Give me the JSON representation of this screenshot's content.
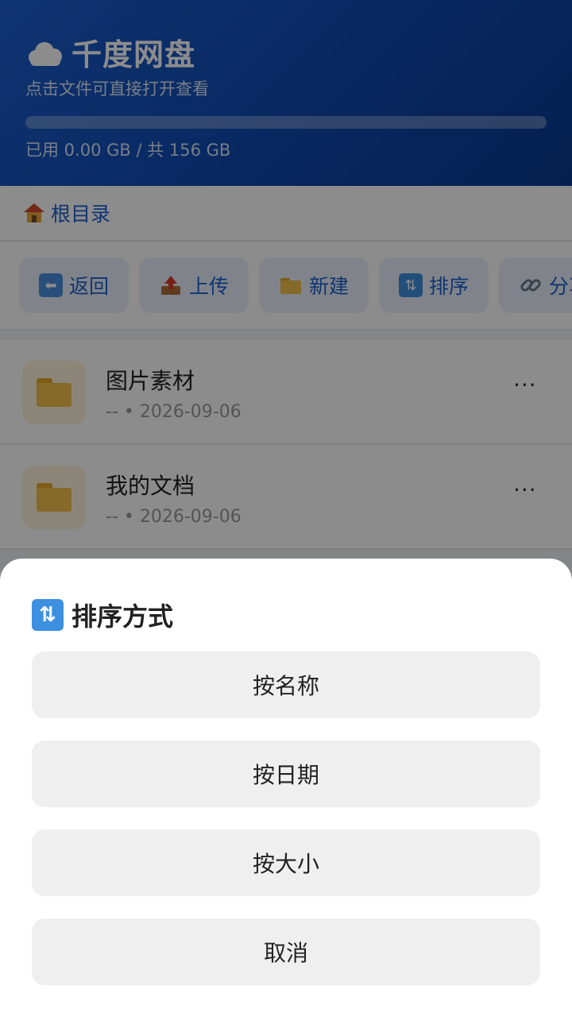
{
  "header": {
    "app_name": "千度网盘",
    "subtitle": "点击文件可直接打开查看",
    "usage_text": "已用 0.00 GB / 共 156 GB",
    "usage_fraction": 0.0
  },
  "breadcrumb": {
    "label": "根目录"
  },
  "toolbar": {
    "buttons": [
      {
        "label": "返回",
        "icon": "back-arrow-icon"
      },
      {
        "label": "上传",
        "icon": "upload-icon"
      },
      {
        "label": "新建",
        "icon": "folder-icon"
      },
      {
        "label": "排序",
        "icon": "sort-icon"
      },
      {
        "label": "分享",
        "icon": "link-icon"
      }
    ]
  },
  "files": [
    {
      "name": "图片素材",
      "size": "--",
      "date": "2026-09-06",
      "more": "···"
    },
    {
      "name": "我的文档",
      "size": "--",
      "date": "2026-09-06",
      "more": "···"
    }
  ],
  "sort_sheet": {
    "title": "排序方式",
    "options": [
      "按名称",
      "按日期",
      "按大小"
    ],
    "cancel": "取消"
  },
  "colors": {
    "accent": "#1a5fcf",
    "folder": "#f4c24c",
    "sheet_button_bg": "#efefef"
  }
}
